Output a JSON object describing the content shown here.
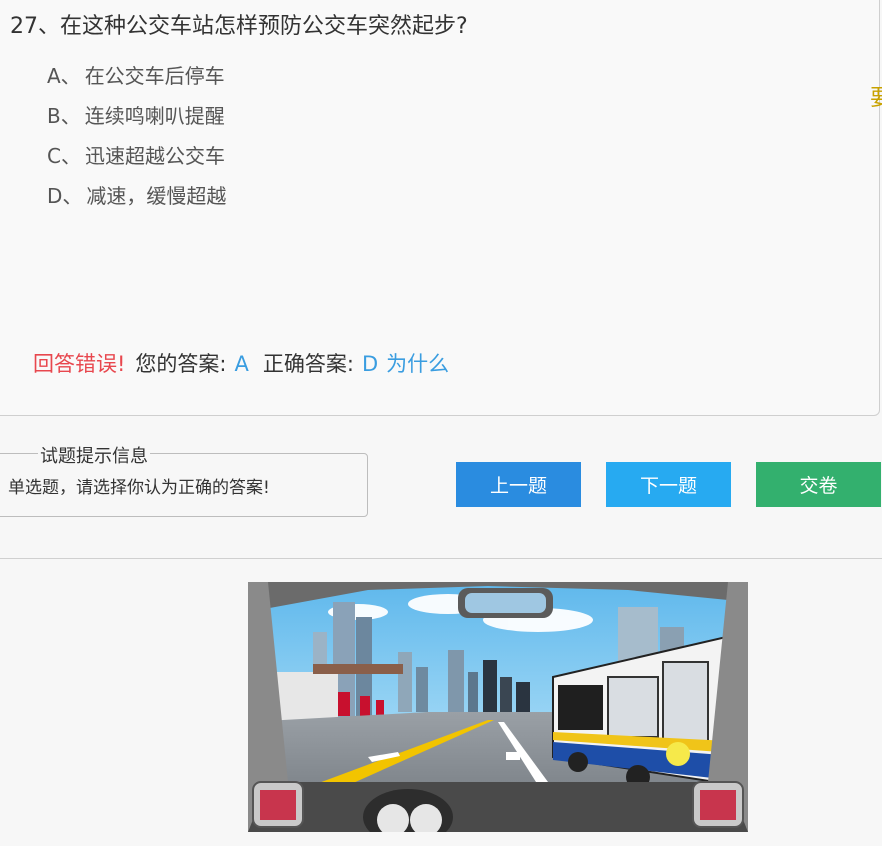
{
  "question": {
    "title": "27、在这种公交车站怎样预防公交车突然起步?",
    "options": [
      {
        "letter": "A、",
        "text": "在公交车后停车"
      },
      {
        "letter": "B、",
        "text": "连续鸣喇叭提醒"
      },
      {
        "letter": "C、",
        "text": "迅速超越公交车"
      },
      {
        "letter": "D、",
        "text": "减速，缓慢超越"
      }
    ]
  },
  "edge_char": "要",
  "result": {
    "status": "回答错误!",
    "your_answer_label": "您的答案:",
    "your_answer": "A",
    "correct_answer_label": "正确答案:",
    "correct_answer": "D",
    "why_link": "为什么"
  },
  "hint": {
    "legend": "试题提示信息",
    "text": "单选题，请选择你认为正确的答案!"
  },
  "buttons": {
    "prev": "上一题",
    "next": "下一题",
    "submit": "交卷"
  },
  "colors": {
    "error": "#e8474e",
    "link": "#3a9de0",
    "prev_button": "#2a8ce0",
    "next_button": "#27aaf1",
    "submit_button": "#33b06e"
  }
}
